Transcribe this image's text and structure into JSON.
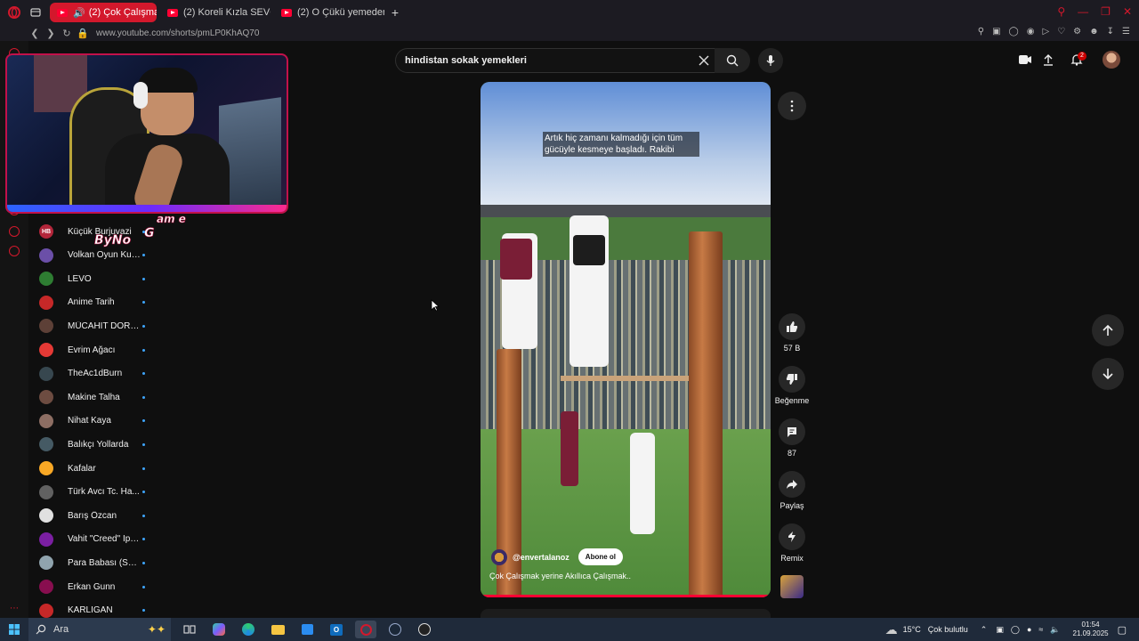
{
  "browser": {
    "tabs": [
      {
        "label": "(2) Çok Çalışmak yeri",
        "active": true
      },
      {
        "label": "(2) Koreli Kızla SEVGİLİ O",
        "active": false
      },
      {
        "label": "(2) O Çükü yemeden dura",
        "active": false
      }
    ],
    "url": "www.youtube.com/shorts/pmLP0KhAQ70"
  },
  "search": {
    "value": "hindistan sokak yemekleri"
  },
  "notifications": {
    "count": "2"
  },
  "logo_mark": {
    "text": "ByNoGame"
  },
  "subscriptions": [
    {
      "name": "Küçük Burjuvazi",
      "initials": "HB",
      "color": "#b3263a"
    },
    {
      "name": "Volkan Oyun Kuv...",
      "initials": "",
      "color": "#6b4fa8"
    },
    {
      "name": "LEVO",
      "initials": "",
      "color": "#2e7d32"
    },
    {
      "name": "Anime Tarih",
      "initials": "",
      "color": "#c62828"
    },
    {
      "name": "MÜCAHİT DORAY",
      "initials": "",
      "color": "#5d4037"
    },
    {
      "name": "Evrim Ağacı",
      "initials": "",
      "color": "#e53935"
    },
    {
      "name": "TheAc1dBurn",
      "initials": "",
      "color": "#37474f"
    },
    {
      "name": "Makine Talha",
      "initials": "",
      "color": "#6d4c41"
    },
    {
      "name": "Nihat Kaya",
      "initials": "",
      "color": "#8d6e63"
    },
    {
      "name": "Balıkçı Yollarda",
      "initials": "",
      "color": "#455a64"
    },
    {
      "name": "Kafalar",
      "initials": "",
      "color": "#f9a825"
    },
    {
      "name": "Türk Avcı Tc. Ha...",
      "initials": "",
      "color": "#616161"
    },
    {
      "name": "Barış Özcan",
      "initials": "",
      "color": "#e0e0e0"
    },
    {
      "name": "Vahit \"Creed\" İpe...",
      "initials": "",
      "color": "#7b1fa2"
    },
    {
      "name": "Para Babası (Sai...",
      "initials": "",
      "color": "#90a4ae"
    },
    {
      "name": "Erkan Gunn",
      "initials": "",
      "color": "#880e4f"
    },
    {
      "name": "KARLIGAN",
      "initials": "",
      "color": "#c62828"
    }
  ],
  "video": {
    "caption": "Artık hiç zamanı kalmadığı için tüm gücüyle kesmeye başladı. Rakibi",
    "channel_handle": "@envertalanoz",
    "subscribe_label": "Abone ol",
    "title": "Çok Çalışmak yerine Akıllıca Çalışmak..",
    "progress": 1.0
  },
  "actions": {
    "likes": "57 B",
    "dislike_label": "Beğenme",
    "comments": "87",
    "share_label": "Paylaş",
    "remix_label": "Remix"
  },
  "taskbar": {
    "search_label": "Ara",
    "weather_temp": "15°C",
    "weather_desc": "Çok bulutlu",
    "time": "01:54",
    "date": "21.09.2025"
  },
  "colors": {
    "accent": "#ff0033",
    "opera": "#d3182c",
    "link_dot": "#3ea6ff"
  }
}
